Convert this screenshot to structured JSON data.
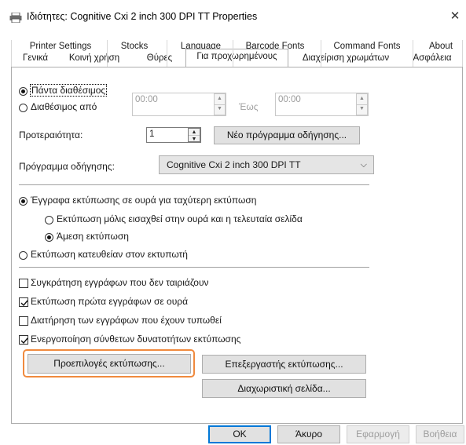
{
  "window": {
    "title": "Ιδιότητες: Cognitive Cxi 2 inch 300 DPI TT Properties",
    "close_glyph": "✕"
  },
  "tabs_row1": [
    "Printer Settings",
    "Stocks",
    "Language",
    "Barcode Fonts",
    "Command Fonts",
    "About"
  ],
  "tabs_row2": [
    "Γενικά",
    "Κοινή χρήση",
    "Θύρες",
    "Για προχωρημένους",
    "Διαχείριση χρωμάτων",
    "Ασφάλεια"
  ],
  "active_tab": "Για προχωρημένους",
  "availability": {
    "always_label": "Πάντα διαθέσιμος",
    "always_selected": true,
    "from_label": "Διαθέσιμος από",
    "from_value": "00:00",
    "to_label": "Έως",
    "to_value": "00:00"
  },
  "priority": {
    "label": "Προτεραιότητα:",
    "value": "1",
    "new_driver_button": "Νέο πρόγραμμα οδήγησης..."
  },
  "driver": {
    "label": "Πρόγραμμα οδήγησης:",
    "selected": "Cognitive Cxi 2 inch 300 DPI TT"
  },
  "spooling": {
    "spool_label": "Έγγραφα εκτύπωσης σε ουρά για ταχύτερη εκτύπωση",
    "spool_selected": true,
    "after_last_page_label": "Εκτύπωση μόλις εισαχθεί στην ουρά και η τελευταία σελίδα",
    "after_last_page_selected": false,
    "immediately_label": "Άμεση εκτύπωση",
    "immediately_selected": true,
    "direct_label": "Εκτύπωση κατευθείαν στον εκτυπωτή",
    "direct_selected": false
  },
  "options": [
    {
      "label": "Συγκράτηση εγγράφων που δεν ταιριάζουν",
      "checked": false
    },
    {
      "label": "Εκτύπωση πρώτα εγγράφων σε ουρά",
      "checked": true
    },
    {
      "label": "Διατήρηση των εγγράφων που έχουν τυπωθεί",
      "checked": false
    },
    {
      "label": "Ενεργοποίηση σύνθετων δυνατοτήτων εκτύπωσης",
      "checked": true
    }
  ],
  "buttons": {
    "printing_defaults": "Προεπιλογές εκτύπωσης...",
    "print_processor": "Επεξεργαστής εκτύπωσης...",
    "separator_page": "Διαχωριστική σελίδα...",
    "ok": "OK",
    "cancel": "Άκυρο",
    "apply": "Εφαρμογή",
    "help": "Βοήθεια"
  },
  "colors": {
    "highlight": "#f08a3e",
    "default_button_border": "#0078d7"
  }
}
